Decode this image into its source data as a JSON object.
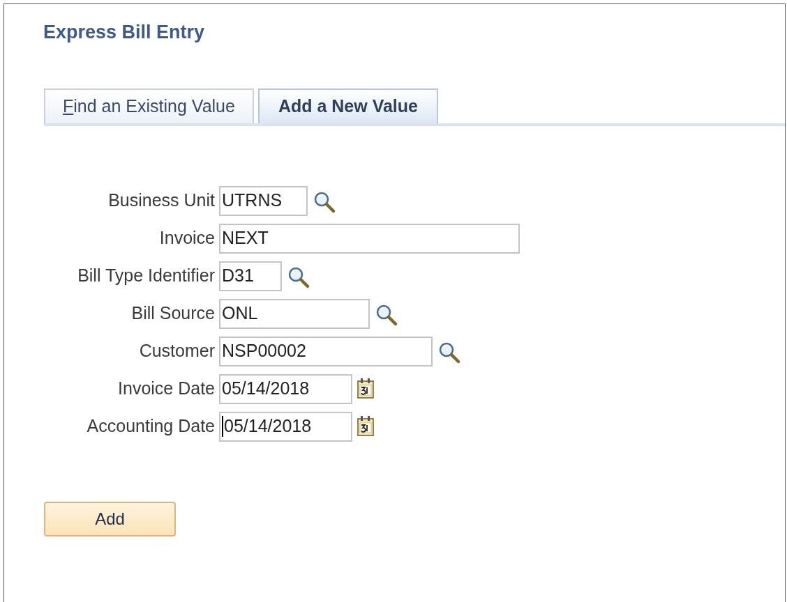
{
  "page_title": "Express Bill Entry",
  "tabs": [
    {
      "label": "Find an Existing Value",
      "selected": false,
      "access_key_underlined": true
    },
    {
      "label": "Add a New Value",
      "selected": true,
      "access_key_underlined": false
    }
  ],
  "fields": [
    {
      "label": "Business Unit",
      "value": "UTRNS",
      "kind": "lookup",
      "focused": false
    },
    {
      "label": "Invoice",
      "value": "NEXT",
      "kind": "plain",
      "focused": false
    },
    {
      "label": "Bill Type Identifier",
      "value": "D31",
      "kind": "lookup",
      "focused": false
    },
    {
      "label": "Bill Source",
      "value": "ONL",
      "kind": "lookup",
      "focused": false
    },
    {
      "label": "Customer",
      "value": "NSP00002",
      "kind": "lookup",
      "focused": false
    },
    {
      "label": "Invoice Date",
      "value": "05/14/2018",
      "kind": "date",
      "focused": false
    },
    {
      "label": "Accounting Date",
      "value": "05/14/2018",
      "kind": "date",
      "focused": true
    }
  ],
  "add_button": "Add"
}
